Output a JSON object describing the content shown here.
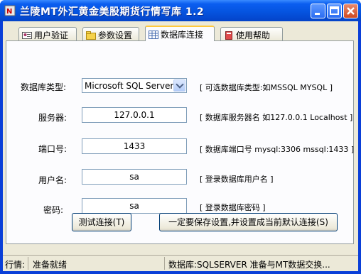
{
  "window": {
    "title": "兰陵MT外汇黄金美股期货行情写库 1.2"
  },
  "tabs": [
    {
      "label": "用户验证",
      "icon": "user-card-icon"
    },
    {
      "label": "参数设置",
      "icon": "folder-icon"
    },
    {
      "label": "数据库连接",
      "icon": "grid-icon",
      "active": true
    },
    {
      "label": "使用帮助",
      "icon": "help-book-icon"
    }
  ],
  "form": {
    "db_type": {
      "label": "数据库类型:",
      "value": "Microsoft SQL Server",
      "hint": "[ 可选数据库类型:如MSSQL MYSQL ]"
    },
    "server": {
      "label": "服务器:",
      "value": "127.0.0.1",
      "hint": "[ 数据库服务器名 如127.0.0.1 Localhost ]"
    },
    "port": {
      "label": "端口号:",
      "value": "1433",
      "hint": "[ 数据库端口号 mysql:3306 mssql:1433 ]"
    },
    "username": {
      "label": "用户名:",
      "value": "sa",
      "hint": "[ 登录数据库用户名 ]"
    },
    "password": {
      "label": "密码:",
      "value": "sa",
      "hint": "[ 登录数据库密码 ]"
    }
  },
  "buttons": {
    "test": "测试连接(T)",
    "save": "一定要保存设置,并设置成当前默认连接(S)"
  },
  "status": {
    "label": "行情:",
    "state": "准备就绪",
    "db_message": "数据库:SQLSERVER 准备与MT数据交换..."
  },
  "colors": {
    "titlebar": "#0554e0",
    "face": "#ece9d8",
    "close": "#cf4a22"
  }
}
